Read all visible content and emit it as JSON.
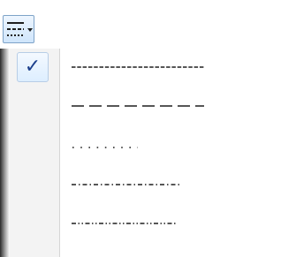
{
  "toolbar": {
    "dash_style_button": {
      "icon": "dash-style-icon",
      "has_dropdown": true
    }
  },
  "dash_menu": {
    "items": [
      {
        "style": "solid",
        "checked": true,
        "check_glyph": "✓"
      },
      {
        "style": "dash",
        "checked": false,
        "check_glyph": ""
      },
      {
        "style": "dot",
        "checked": false,
        "check_glyph": ""
      },
      {
        "style": "dash-dot",
        "checked": false,
        "check_glyph": ""
      },
      {
        "style": "dash-dot-dot",
        "checked": false,
        "check_glyph": ""
      }
    ]
  },
  "colors": {
    "line": "#1f1f1f",
    "check": "#1c3f8c",
    "button_border": "#7ea3c8",
    "gutter": "#f3f3f3"
  }
}
